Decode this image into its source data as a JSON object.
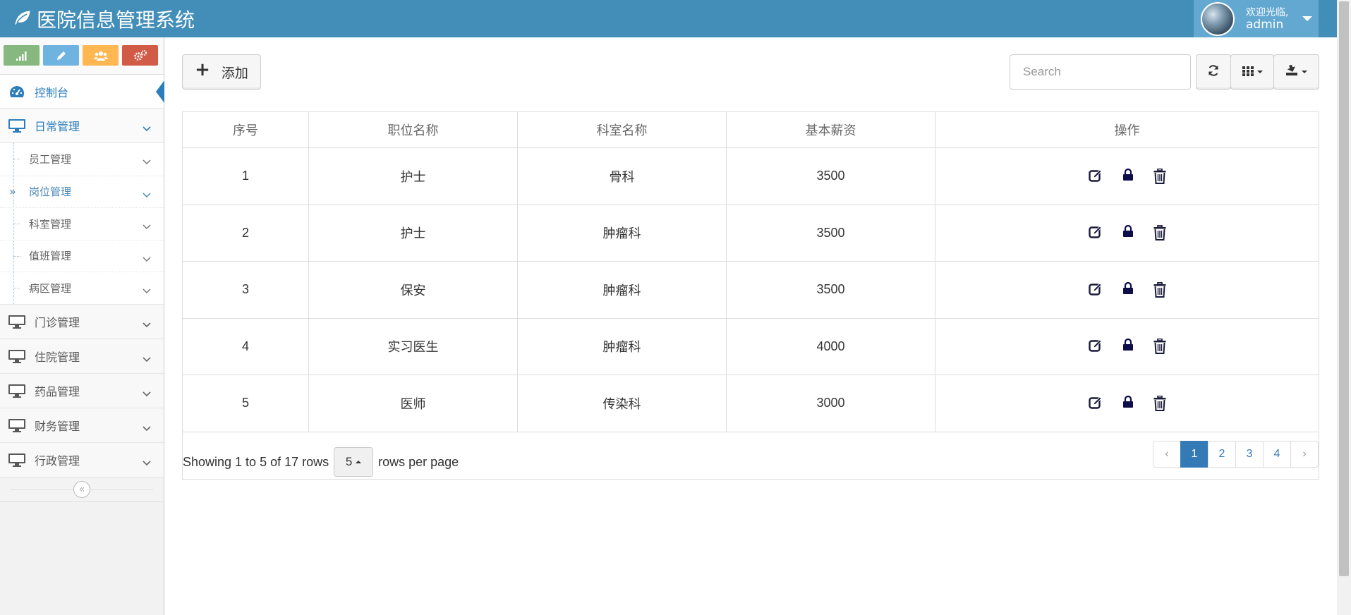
{
  "header": {
    "app_title": "医院信息管理系统",
    "welcome": "欢迎光临,",
    "username": "admin"
  },
  "sidebar": {
    "shortcuts": [
      "signal-icon",
      "pencil-icon",
      "users-icon",
      "cogs-icon"
    ],
    "dashboard": "控制台",
    "daily": {
      "label": "日常管理",
      "children": [
        "员工管理",
        "岗位管理",
        "科室管理",
        "值班管理",
        "病区管理"
      ]
    },
    "sections": [
      "门诊管理",
      "住院管理",
      "药品管理",
      "财务管理",
      "行政管理"
    ]
  },
  "toolbar": {
    "add_label": "添加",
    "search_placeholder": "Search"
  },
  "table": {
    "columns": [
      "序号",
      "职位名称",
      "科室名称",
      "基本薪资",
      "操作"
    ],
    "rows": [
      [
        "1",
        "护士",
        "骨科",
        "3500"
      ],
      [
        "2",
        "护士",
        "肿瘤科",
        "3500"
      ],
      [
        "3",
        "保安",
        "肿瘤科",
        "3500"
      ],
      [
        "4",
        "实习医生",
        "肿瘤科",
        "4000"
      ],
      [
        "5",
        "医师",
        "传染科",
        "3000"
      ]
    ]
  },
  "pagination": {
    "info_prefix": "Showing 1 to 5 of 17 rows",
    "page_size": "5",
    "info_suffix": "rows per page",
    "prev": "‹",
    "pages": [
      "1",
      "2",
      "3",
      "4"
    ],
    "next": "›"
  },
  "colors": {
    "header": "#438eb9",
    "user_box": "#62a8d1",
    "accent": "#2b7dbc",
    "pager_active": "#337ab7"
  }
}
